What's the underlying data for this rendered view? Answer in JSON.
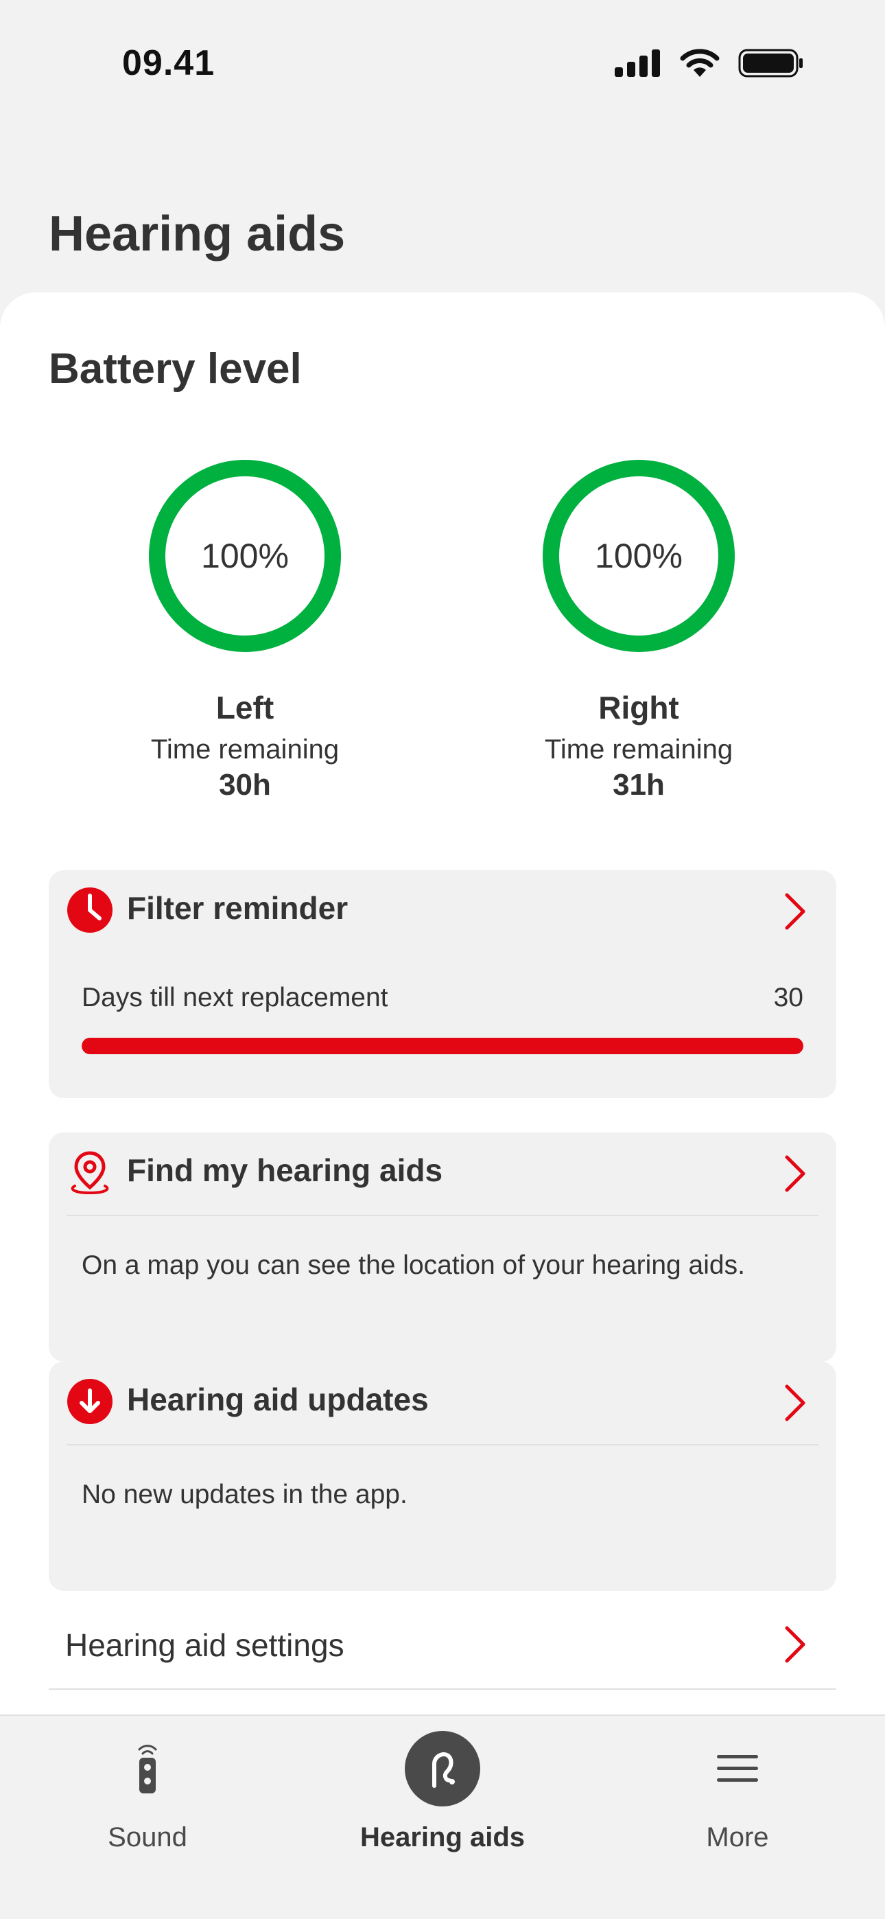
{
  "status_bar": {
    "time": "09.41"
  },
  "page": {
    "title": "Hearing aids"
  },
  "battery": {
    "title": "Battery level",
    "left": {
      "percent_text": "100%",
      "percent_value": 100,
      "side": "Left",
      "time_label": "Time remaining",
      "time_value": "30h"
    },
    "right": {
      "percent_text": "100%",
      "percent_value": 100,
      "side": "Right",
      "time_label": "Time remaining",
      "time_value": "31h"
    },
    "ring_color": "#00b140"
  },
  "filter_reminder": {
    "title": "Filter reminder",
    "label": "Days till next replacement",
    "days": "30",
    "progress_fraction": 1.0
  },
  "find_hearing_aids": {
    "title": "Find my hearing aids",
    "description": "On a map you can see the location of your hearing aids."
  },
  "updates": {
    "title": "Hearing aid updates",
    "description": "No new updates in the app."
  },
  "settings": {
    "label": "Hearing aid settings"
  },
  "tab_bar": {
    "tabs": [
      {
        "label": "Sound",
        "icon": "remote-control-icon"
      },
      {
        "label": "Hearing aids",
        "icon": "hearing-aid-icon",
        "active": true
      },
      {
        "label": "More",
        "icon": "menu-icon"
      }
    ]
  },
  "colors": {
    "accent": "#e30613",
    "battery_green": "#00b140",
    "text": "#333333"
  }
}
